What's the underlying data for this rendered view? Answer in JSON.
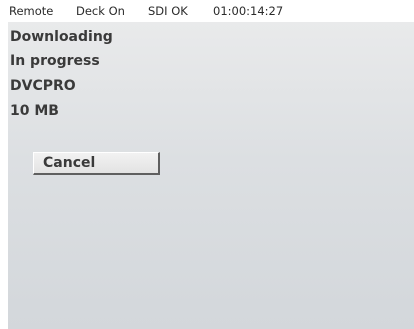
{
  "status_bar": {
    "remote": "Remote",
    "deck": "Deck On",
    "sdi": "SDI OK",
    "timecode": "01:00:14:27"
  },
  "panel": {
    "title": "Downloading",
    "progress_status": "In progress",
    "format": "DVCPRO",
    "size": "10 MB",
    "cancel_label": "Cancel"
  },
  "colors": {
    "panel_background": "#dcdfe2",
    "text": "#3a3a3a"
  }
}
